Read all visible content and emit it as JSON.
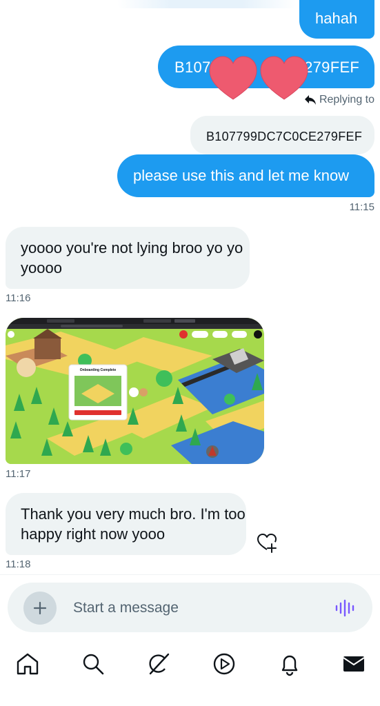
{
  "messages": {
    "sent_hahah": "hahah",
    "sent_code": "B1077",
    "sent_code_tail": "E279FEF",
    "reply_label": "Replying to",
    "quoted_text": "B107799DC7C0CE279FEF",
    "sent_please": "please use this and let me know",
    "time_1": "11:15",
    "recv_yoooo": "yoooo you're not lying broo yo yo yoooo",
    "time_2": "11:16",
    "media_popup_title": "Onboarding Complete",
    "time_3": "11:17",
    "recv_thanks": "Thank you very much bro. I'm too happy right now yooo",
    "time_4": "11:18"
  },
  "composer": {
    "placeholder": "Start a message"
  },
  "nav": {
    "items": [
      "home-icon",
      "search-icon",
      "grok-icon",
      "video-icon",
      "notifications-icon",
      "messages-icon"
    ]
  },
  "colors": {
    "accent": "#1d9bf0",
    "received_bubble": "#eef3f4",
    "heart": "#ee5a6f",
    "voice": "#7856ff"
  }
}
